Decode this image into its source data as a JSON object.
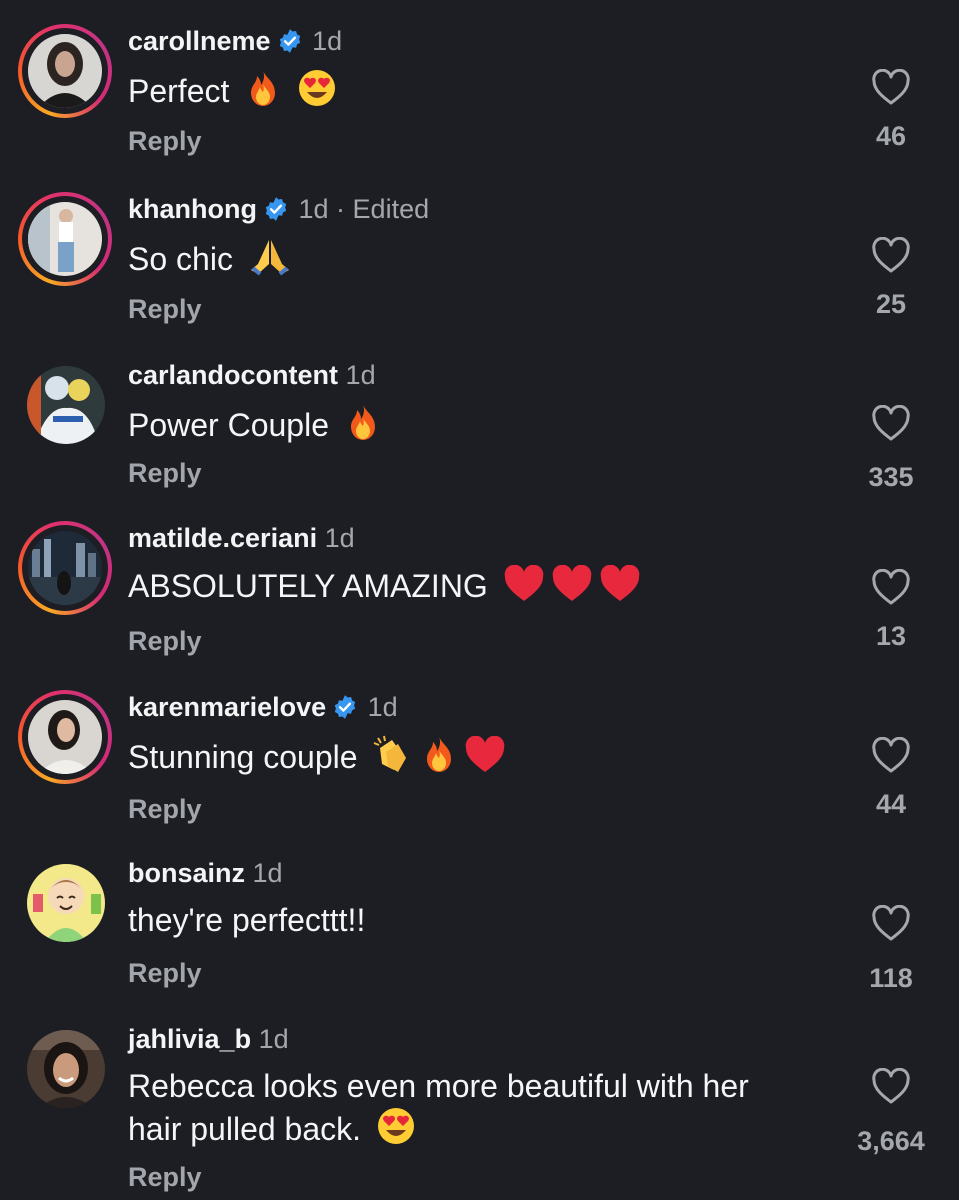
{
  "comments": [
    {
      "username": "carollneme",
      "verified": true,
      "time": "1d",
      "text": "Perfect",
      "emojis": [
        "fire",
        "heart-eyes"
      ],
      "reply": "Reply",
      "likes": "46"
    },
    {
      "username": "khanhong",
      "verified": true,
      "time": "1d · Edited",
      "text": "So chic",
      "emojis": [
        "folded-hands"
      ],
      "reply": "Reply",
      "likes": "25"
    },
    {
      "username": "carlandocontent",
      "verified": false,
      "time": "1d",
      "text": "Power Couple",
      "emojis": [
        "fire"
      ],
      "reply": "Reply",
      "likes": "335"
    },
    {
      "username": "matilde.ceriani",
      "verified": false,
      "time": "1d",
      "text": "ABSOLUTELY AMAZING",
      "emojis": [
        "red-heart",
        "red-heart",
        "red-heart"
      ],
      "reply": "Reply",
      "likes": "13"
    },
    {
      "username": "karenmarielove",
      "verified": true,
      "time": "1d",
      "text": "Stunning couple",
      "emojis": [
        "clapping-hands",
        "fire",
        "red-heart"
      ],
      "reply": "Reply",
      "likes": "44"
    },
    {
      "username": "bonsainz",
      "verified": false,
      "time": "1d",
      "text": "they're perfecttt!!",
      "emojis": [],
      "reply": "Reply",
      "likes": "118"
    },
    {
      "username": "jahlivia_b",
      "verified": false,
      "time": "1d",
      "text_line1": "Rebecca looks even more beautiful with her",
      "text_line2": "hair pulled back.",
      "emojis": [
        "heart-eyes"
      ],
      "reply": "Reply",
      "likes": "3,664"
    }
  ],
  "colors": {
    "background": "#1d1e23",
    "verified": "#3797f0",
    "muted": "#a4a7ad"
  }
}
